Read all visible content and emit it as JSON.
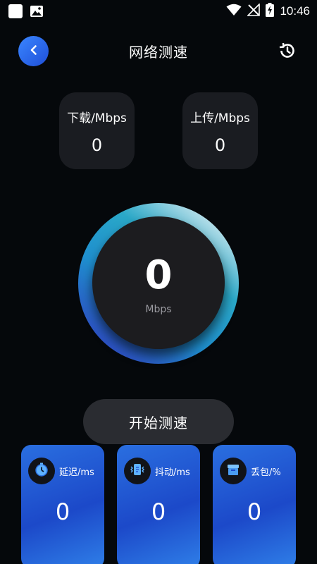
{
  "status_bar": {
    "time": "10:46",
    "icons": [
      "notification-square-icon",
      "image-icon",
      "wifi-icon",
      "no-signal-icon",
      "battery-charging-icon"
    ]
  },
  "header": {
    "title": "网络测速",
    "back_icon": "chevron-left-icon",
    "history_icon": "history-icon"
  },
  "stats": {
    "download": {
      "label": "下载/Mbps",
      "value": "0"
    },
    "upload": {
      "label": "上传/Mbps",
      "value": "0"
    }
  },
  "gauge": {
    "value": "0",
    "unit": "Mbps"
  },
  "start_button": {
    "label": "开始测速"
  },
  "metrics": [
    {
      "label": "延迟/ms",
      "value": "0",
      "icon": "stopwatch-icon"
    },
    {
      "label": "抖动/ms",
      "value": "0",
      "icon": "jitter-icon"
    },
    {
      "label": "丢包/%",
      "value": "0",
      "icon": "package-icon"
    }
  ],
  "colors": {
    "background": "#05080b",
    "card": "#1a1c21",
    "accent_blue": "#2a6fe0",
    "gauge_cyan": "#2aa0c4"
  }
}
